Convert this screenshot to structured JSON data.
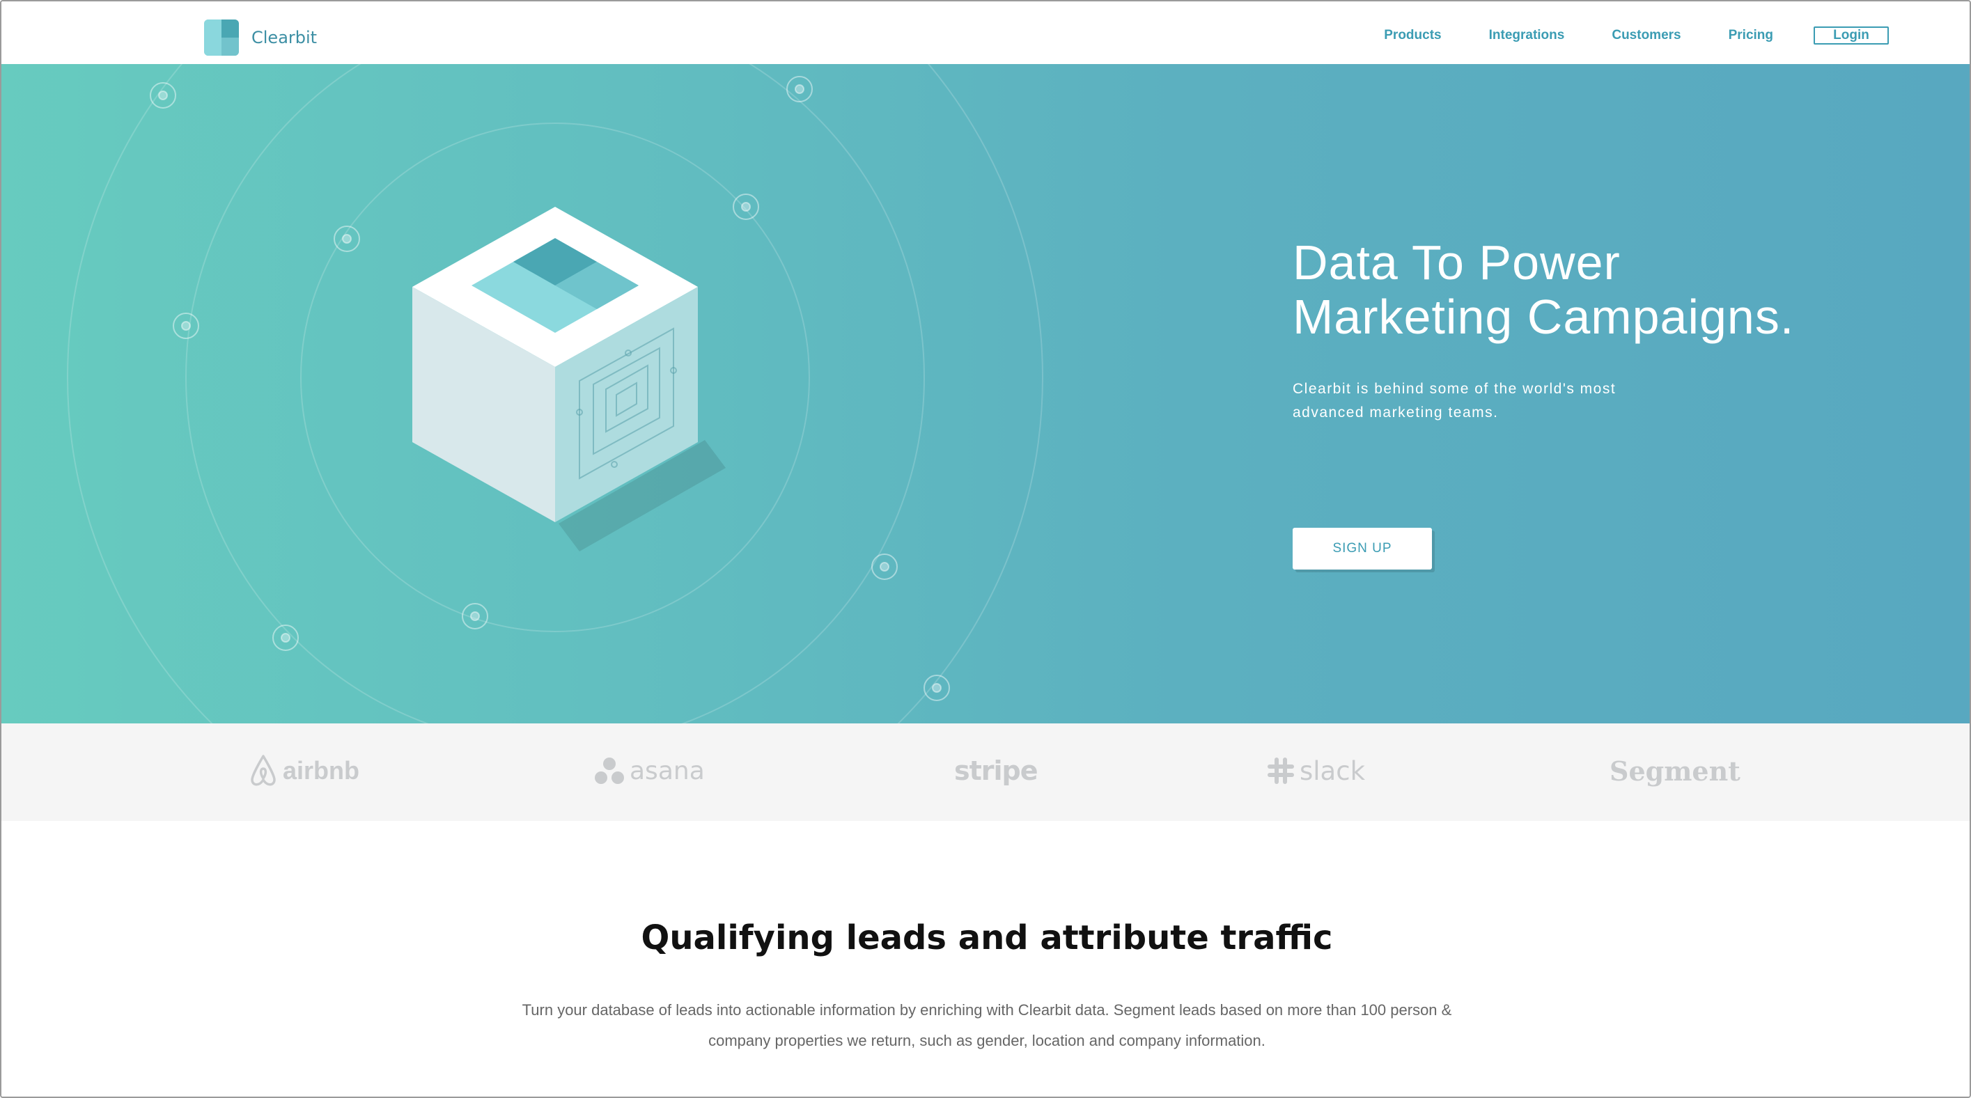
{
  "header": {
    "brand": "Clearbit",
    "nav": [
      {
        "label": "Products"
      },
      {
        "label": "Integrations"
      },
      {
        "label": "Customers"
      },
      {
        "label": "Pricing"
      }
    ],
    "login_label": "Login"
  },
  "hero": {
    "title_line1": "Data To Power",
    "title_line2": "Marketing Campaigns.",
    "subtitle": "Clearbit is behind some of the world's most advanced marketing teams.",
    "cta_label": "SIGN UP"
  },
  "customers": {
    "logos": [
      {
        "name": "airbnb",
        "icon": "airbnb-icon"
      },
      {
        "name": "asana",
        "icon": "asana-icon"
      },
      {
        "name": "stripe",
        "icon": ""
      },
      {
        "name": "slack",
        "icon": "slack-icon"
      },
      {
        "name": "Segment",
        "icon": ""
      }
    ]
  },
  "features": {
    "title": "Qualifying leads and attribute traffic",
    "body": "Turn your database of leads into actionable information by enriching with Clearbit data. Segment leads based on more than 100 person & company properties we return, such as gender, location and company information."
  },
  "colors": {
    "accent": "#3b9cb3",
    "hero_start": "#67cbbf",
    "hero_end": "#58a8c0",
    "logo_gray": "#c9cbcd"
  }
}
